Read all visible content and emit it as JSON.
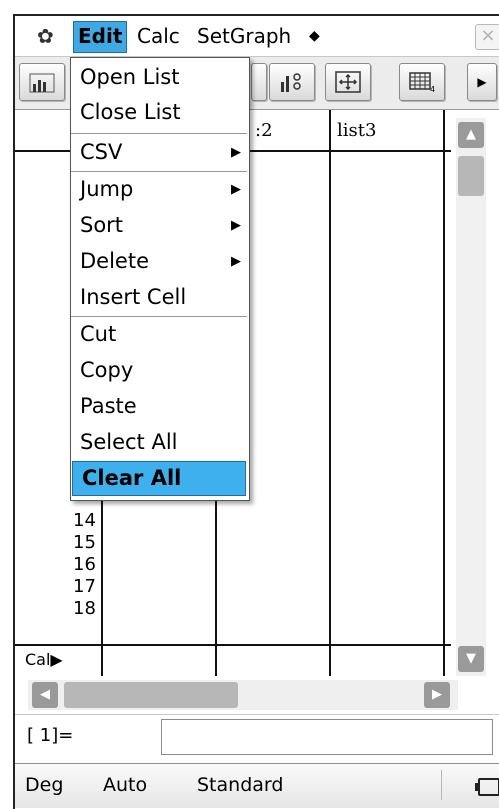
{
  "menubar": {
    "items": [
      "Edit",
      "Calc",
      "SetGraph"
    ],
    "more_glyph": "◆",
    "close_glyph": "×"
  },
  "edit_menu": {
    "items": [
      {
        "label": "Open List",
        "submenu": false
      },
      {
        "label": "Close List",
        "submenu": false
      },
      {
        "label": "CSV",
        "submenu": true
      },
      {
        "label": "Jump",
        "submenu": true
      },
      {
        "label": "Sort",
        "submenu": true
      },
      {
        "label": "Delete",
        "submenu": true
      },
      {
        "label": "Insert Cell",
        "submenu": false
      },
      {
        "label": "Cut",
        "submenu": false
      },
      {
        "label": "Copy",
        "submenu": false
      },
      {
        "label": "Paste",
        "submenu": false
      },
      {
        "label": "Select All",
        "submenu": false
      },
      {
        "label": "Clear All",
        "submenu": false,
        "selected": true
      }
    ],
    "highlight_color": "#3fb0ee"
  },
  "sheet": {
    "visible_col_header_fragment": ":2",
    "col3_header": "list3",
    "row_numbers": [
      "14",
      "15",
      "16",
      "17",
      "18"
    ],
    "cal_row_label": "Cal▶"
  },
  "entry": {
    "label": "[  1]="
  },
  "status": {
    "angle": "Deg",
    "mode": "Auto",
    "format": "Standard"
  },
  "colors": {
    "accent": "#3fa9e6"
  }
}
